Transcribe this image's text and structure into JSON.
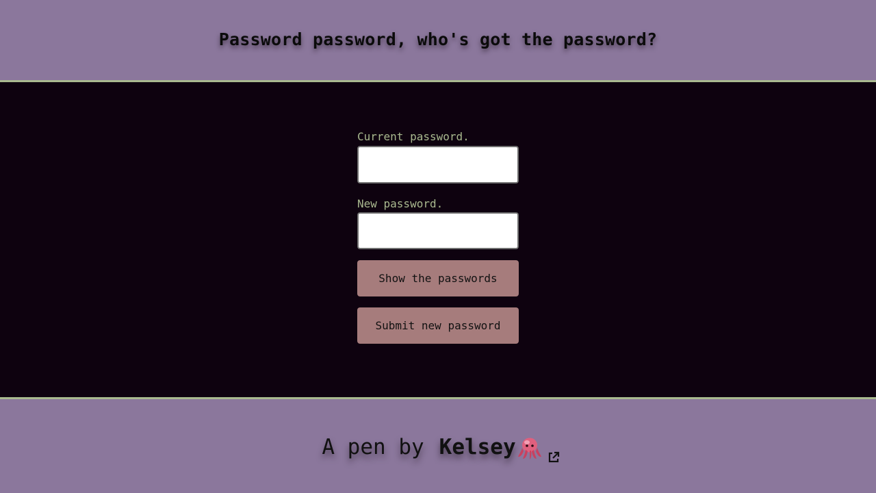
{
  "header": {
    "title": "Password password, who's got the password?"
  },
  "form": {
    "current_label": "Current password.",
    "current_value": "",
    "new_label": "New password.",
    "new_value": "",
    "show_button_label": "Show the passwords",
    "submit_button_label": "Submit new password"
  },
  "footer": {
    "prefix": "A pen by",
    "author": "Kelsey",
    "author_icon": "octopus-icon",
    "link_icon": "external-link-icon"
  },
  "colors": {
    "header_bg": "#8b779c",
    "main_bg": "#0e020f",
    "accent_border": "#a9b98f",
    "label_text": "#a9b98f",
    "button_bg": "#a67c7c"
  }
}
